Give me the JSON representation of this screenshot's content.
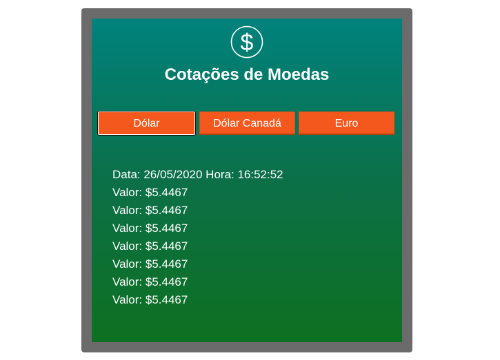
{
  "app": {
    "title": "Cotações de Moedas",
    "logo_icon": "dollar-circle-icon",
    "colors": {
      "frame": "#6b6b6b",
      "panel_top": "#00827d",
      "panel_bottom": "#0e7020",
      "button": "#f4581c",
      "text": "#ffffff"
    }
  },
  "tabs": [
    {
      "label": "Dólar",
      "active": true
    },
    {
      "label": "Dólar Canadá",
      "active": false
    },
    {
      "label": "Euro",
      "active": false
    }
  ],
  "quotes": {
    "date_line": "Data: 26/05/2020 Hora: 16:52:52",
    "values": [
      "Valor: $5.4467",
      "Valor: $5.4467",
      "Valor: $5.4467",
      "Valor: $5.4467",
      "Valor: $5.4467",
      "Valor: $5.4467",
      "Valor: $5.4467"
    ]
  }
}
